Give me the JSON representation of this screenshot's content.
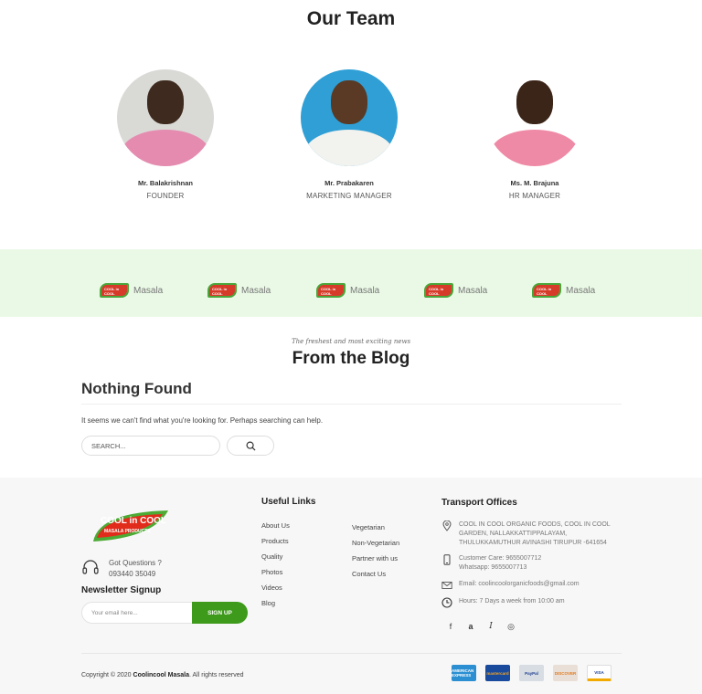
{
  "team": {
    "title": "Our Team",
    "members": [
      {
        "name": "Mr. Balakrishnan",
        "role": "FOUNDER"
      },
      {
        "name": "Mr. Prabakaren",
        "role": "MARKETING MANAGER"
      },
      {
        "name": "Ms. M. Brajuna",
        "role": "HR MANAGER"
      }
    ]
  },
  "brands": {
    "items": [
      {
        "logo_text": "COOL in COOL",
        "label": "Masala"
      },
      {
        "logo_text": "COOL in COOL",
        "label": "Masala"
      },
      {
        "logo_text": "COOL in COOL",
        "label": "Masala"
      },
      {
        "logo_text": "COOL in COOL",
        "label": "Masala"
      },
      {
        "logo_text": "COOL in COOL",
        "label": "Masala"
      }
    ]
  },
  "blog": {
    "tagline": "The freshest and most exciting news",
    "title": "From the Blog",
    "nothing_found": "Nothing Found",
    "message": "It seems we can't find what you're looking for. Perhaps searching can help.",
    "search_placeholder": "SEARCH..."
  },
  "footer": {
    "logo_text": "COOL in COOL",
    "logo_sub": "MASALA PRODUCTS",
    "questions_label": "Got Questions ?",
    "phone": "093440 35049",
    "newsletter_title": "Newsletter Signup",
    "email_placeholder": "Your email here...",
    "signup_label": "SIGN UP",
    "useful_links_title": "Useful Links",
    "links_col1": [
      "About Us",
      "Products",
      "Quality",
      "Photos",
      "Videos",
      "Blog"
    ],
    "links_col2": [
      "Vegetarian",
      "Non-Vegetarian",
      "Partner with us",
      "Contact Us"
    ],
    "transport_title": "Transport Offices",
    "address": "COOL IN COOL ORGANIC FOODS, COOL IN COOL GARDEN, NALLAKKATTIPPALAYAM, THULUKKAMUTHUR AVINASHI TIRUPUR -641654",
    "customer_care": "Customer Care: 9655007712",
    "whatsapp": "Whatsapp: 9655007713",
    "email": "Email: coolincoolorganicfoods@gmail.com",
    "hours": "Hours: 7 Days a week from 10:00 am",
    "social": [
      "f",
      "a",
      "I",
      "◎"
    ],
    "copyright_prefix": "Copyright © 2020 ",
    "copyright_brand": "Coolincool Masala",
    "copyright_suffix": ". All rights reserved",
    "payments": [
      "AMERICAN EXPRESS",
      "mastercard",
      "PayPal",
      "DISCOVER",
      "VISA"
    ]
  },
  "colors": {
    "accent": "#3d9a1b",
    "brand_band": "#eaf9e6",
    "footer_bg": "#f7f7f7"
  }
}
